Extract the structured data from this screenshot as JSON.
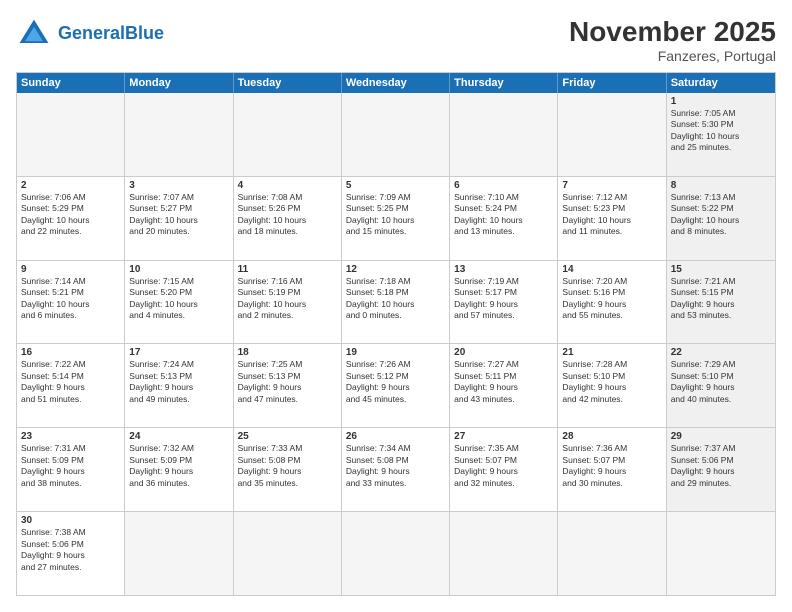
{
  "header": {
    "logo_general": "General",
    "logo_blue": "Blue",
    "month_title": "November 2025",
    "location": "Fanzeres, Portugal"
  },
  "days_of_week": [
    "Sunday",
    "Monday",
    "Tuesday",
    "Wednesday",
    "Thursday",
    "Friday",
    "Saturday"
  ],
  "rows": [
    {
      "cells": [
        {
          "day": "",
          "empty": true
        },
        {
          "day": "",
          "empty": true
        },
        {
          "day": "",
          "empty": true
        },
        {
          "day": "",
          "empty": true
        },
        {
          "day": "",
          "empty": true
        },
        {
          "day": "",
          "empty": true
        },
        {
          "day": "1",
          "shaded": true,
          "text": "Sunrise: 7:05 AM\nSunset: 5:30 PM\nDaylight: 10 hours\nand 25 minutes."
        }
      ]
    },
    {
      "cells": [
        {
          "day": "2",
          "shaded": false,
          "text": "Sunrise: 7:06 AM\nSunset: 5:29 PM\nDaylight: 10 hours\nand 22 minutes."
        },
        {
          "day": "3",
          "shaded": false,
          "text": "Sunrise: 7:07 AM\nSunset: 5:27 PM\nDaylight: 10 hours\nand 20 minutes."
        },
        {
          "day": "4",
          "shaded": false,
          "text": "Sunrise: 7:08 AM\nSunset: 5:26 PM\nDaylight: 10 hours\nand 18 minutes."
        },
        {
          "day": "5",
          "shaded": false,
          "text": "Sunrise: 7:09 AM\nSunset: 5:25 PM\nDaylight: 10 hours\nand 15 minutes."
        },
        {
          "day": "6",
          "shaded": false,
          "text": "Sunrise: 7:10 AM\nSunset: 5:24 PM\nDaylight: 10 hours\nand 13 minutes."
        },
        {
          "day": "7",
          "shaded": false,
          "text": "Sunrise: 7:12 AM\nSunset: 5:23 PM\nDaylight: 10 hours\nand 11 minutes."
        },
        {
          "day": "8",
          "shaded": true,
          "text": "Sunrise: 7:13 AM\nSunset: 5:22 PM\nDaylight: 10 hours\nand 8 minutes."
        }
      ]
    },
    {
      "cells": [
        {
          "day": "9",
          "shaded": false,
          "text": "Sunrise: 7:14 AM\nSunset: 5:21 PM\nDaylight: 10 hours\nand 6 minutes."
        },
        {
          "day": "10",
          "shaded": false,
          "text": "Sunrise: 7:15 AM\nSunset: 5:20 PM\nDaylight: 10 hours\nand 4 minutes."
        },
        {
          "day": "11",
          "shaded": false,
          "text": "Sunrise: 7:16 AM\nSunset: 5:19 PM\nDaylight: 10 hours\nand 2 minutes."
        },
        {
          "day": "12",
          "shaded": false,
          "text": "Sunrise: 7:18 AM\nSunset: 5:18 PM\nDaylight: 10 hours\nand 0 minutes."
        },
        {
          "day": "13",
          "shaded": false,
          "text": "Sunrise: 7:19 AM\nSunset: 5:17 PM\nDaylight: 9 hours\nand 57 minutes."
        },
        {
          "day": "14",
          "shaded": false,
          "text": "Sunrise: 7:20 AM\nSunset: 5:16 PM\nDaylight: 9 hours\nand 55 minutes."
        },
        {
          "day": "15",
          "shaded": true,
          "text": "Sunrise: 7:21 AM\nSunset: 5:15 PM\nDaylight: 9 hours\nand 53 minutes."
        }
      ]
    },
    {
      "cells": [
        {
          "day": "16",
          "shaded": false,
          "text": "Sunrise: 7:22 AM\nSunset: 5:14 PM\nDaylight: 9 hours\nand 51 minutes."
        },
        {
          "day": "17",
          "shaded": false,
          "text": "Sunrise: 7:24 AM\nSunset: 5:13 PM\nDaylight: 9 hours\nand 49 minutes."
        },
        {
          "day": "18",
          "shaded": false,
          "text": "Sunrise: 7:25 AM\nSunset: 5:13 PM\nDaylight: 9 hours\nand 47 minutes."
        },
        {
          "day": "19",
          "shaded": false,
          "text": "Sunrise: 7:26 AM\nSunset: 5:12 PM\nDaylight: 9 hours\nand 45 minutes."
        },
        {
          "day": "20",
          "shaded": false,
          "text": "Sunrise: 7:27 AM\nSunset: 5:11 PM\nDaylight: 9 hours\nand 43 minutes."
        },
        {
          "day": "21",
          "shaded": false,
          "text": "Sunrise: 7:28 AM\nSunset: 5:10 PM\nDaylight: 9 hours\nand 42 minutes."
        },
        {
          "day": "22",
          "shaded": true,
          "text": "Sunrise: 7:29 AM\nSunset: 5:10 PM\nDaylight: 9 hours\nand 40 minutes."
        }
      ]
    },
    {
      "cells": [
        {
          "day": "23",
          "shaded": false,
          "text": "Sunrise: 7:31 AM\nSunset: 5:09 PM\nDaylight: 9 hours\nand 38 minutes."
        },
        {
          "day": "24",
          "shaded": false,
          "text": "Sunrise: 7:32 AM\nSunset: 5:09 PM\nDaylight: 9 hours\nand 36 minutes."
        },
        {
          "day": "25",
          "shaded": false,
          "text": "Sunrise: 7:33 AM\nSunset: 5:08 PM\nDaylight: 9 hours\nand 35 minutes."
        },
        {
          "day": "26",
          "shaded": false,
          "text": "Sunrise: 7:34 AM\nSunset: 5:08 PM\nDaylight: 9 hours\nand 33 minutes."
        },
        {
          "day": "27",
          "shaded": false,
          "text": "Sunrise: 7:35 AM\nSunset: 5:07 PM\nDaylight: 9 hours\nand 32 minutes."
        },
        {
          "day": "28",
          "shaded": false,
          "text": "Sunrise: 7:36 AM\nSunset: 5:07 PM\nDaylight: 9 hours\nand 30 minutes."
        },
        {
          "day": "29",
          "shaded": true,
          "text": "Sunrise: 7:37 AM\nSunset: 5:06 PM\nDaylight: 9 hours\nand 29 minutes."
        }
      ]
    },
    {
      "cells": [
        {
          "day": "30",
          "shaded": false,
          "text": "Sunrise: 7:38 AM\nSunset: 5:06 PM\nDaylight: 9 hours\nand 27 minutes."
        },
        {
          "day": "",
          "empty": true
        },
        {
          "day": "",
          "empty": true
        },
        {
          "day": "",
          "empty": true
        },
        {
          "day": "",
          "empty": true
        },
        {
          "day": "",
          "empty": true
        },
        {
          "day": "",
          "empty": true
        }
      ]
    }
  ]
}
